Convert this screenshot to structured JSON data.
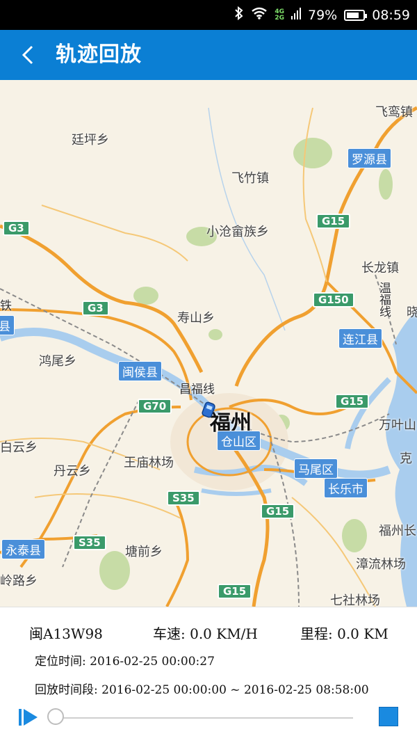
{
  "status_bar": {
    "battery_percent": "79%",
    "time": "08:59",
    "net_4g": "4G",
    "net_2g": "2G",
    "battery_level": 0.79
  },
  "header": {
    "title": "轨迹回放"
  },
  "map": {
    "places": [
      "廷坪乡",
      "飞竹镇",
      "小沧畲族乡",
      "寿山乡",
      "鸿尾乡",
      "丹云乡",
      "王庙林场",
      "塘前乡",
      "长龙镇",
      "万叶山",
      "漳流林场",
      "七社林场",
      "飞鸾镇",
      "岭路乡",
      "白云乡",
      "克",
      "晓",
      "福州长"
    ],
    "city": "福州",
    "counties": [
      "罗源县",
      "连江县",
      "闽侯县",
      "仓山区",
      "马尾区",
      "长乐市",
      "永泰县",
      "县"
    ],
    "highways": [
      "G3",
      "G3",
      "G15",
      "G150",
      "G15",
      "G70",
      "S35",
      "G15",
      "S35",
      "G15"
    ],
    "railway_labels": [
      "昌福线",
      "温福线",
      "铁"
    ]
  },
  "info": {
    "plate": "闽A13W98",
    "speed": "车速: 0.0 KM/H",
    "mileage": "里程: 0.0 KM",
    "position_time": "定位时间: 2016-02-25 00:00:27",
    "playback_period": "回放时间段: 2016-02-25 00:00:00 ~ 2016-02-25 08:58:00"
  },
  "playback": {
    "progress": 0.0
  },
  "colors": {
    "app_bar": "#0b7fd4",
    "status_bar": "#000000",
    "county_badge": "#4a8fd9",
    "highway_shield": "#3a9a6a",
    "road_orange": "#f0a030",
    "water": "#a9cdee",
    "stop_button": "#1a8ae0",
    "play_button": "#1a8ae0"
  }
}
